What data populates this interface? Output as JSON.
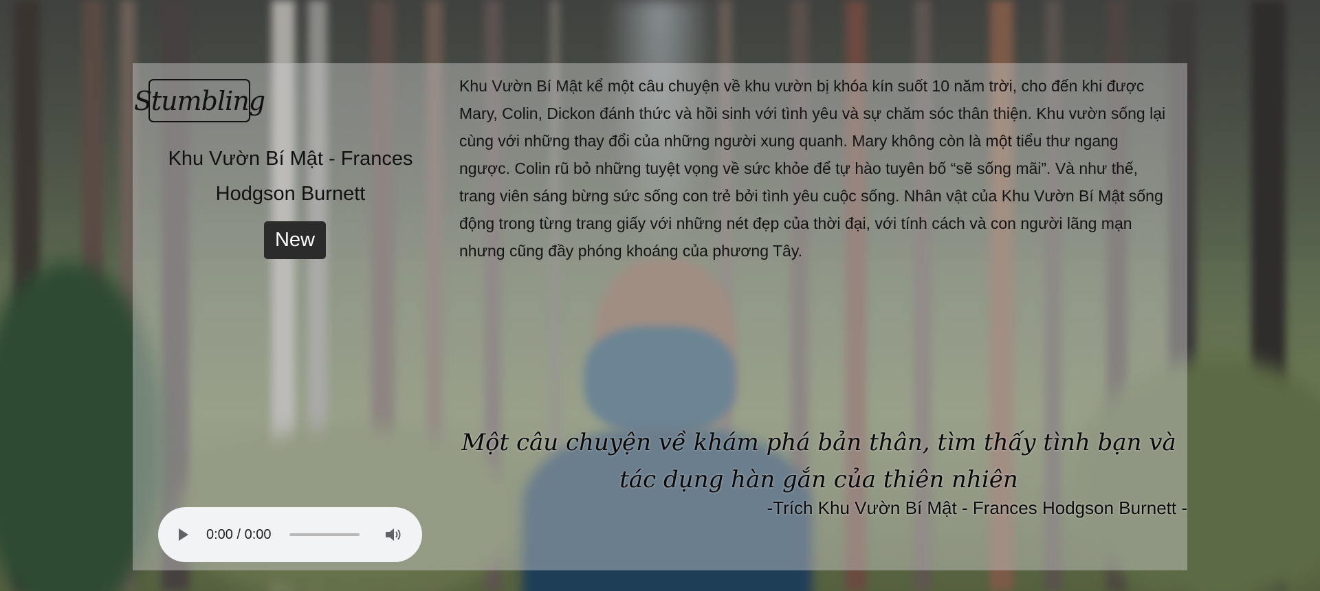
{
  "brand": {
    "logo_text": "Stumbling"
  },
  "book": {
    "title": "Khu Vườn Bí Mật - Frances Hodgson Burnett",
    "badge": "New"
  },
  "description": "Khu Vườn Bí Mật kể một câu chuyện về khu vườn bị khóa kín suốt 10 năm trời, cho đến khi được Mary, Colin, Dickon đánh thức và hồi sinh với tình yêu và sự chăm sóc thân thiện. Khu vườn sống lại cùng với những thay đổi của những người xung quanh. Mary không còn là một tiểu thư ngang ngược. Colin rũ bỏ những tuyệt vọng về sức khỏe để tự hào tuyên bố “sẽ sống mãi”. Và như thế, trang viên sáng bừng sức sống con trẻ bởi tình yêu cuộc sống. Nhân vật của Khu Vườn Bí Mật sống động trong từng trang giấy với những nét đẹp của thời đại, với tính cách và con người lãng mạn nhưng cũng đầy phóng khoáng của phương Tây.",
  "quote": {
    "text": "Một câu chuyện về khám phá bản thân, tìm thấy tình bạn và tác dụng hàn gắn của thiên nhiên",
    "source": "-Trích Khu Vườn Bí Mật - Frances Hodgson Burnett -"
  },
  "audio": {
    "time": "0:00 / 0:00",
    "play_icon": "play-icon",
    "volume_icon": "volume-icon"
  },
  "colors": {
    "badge_bg": "#2b2b2b",
    "badge_text": "#ffffff",
    "player_bg": "#f1f3f4"
  }
}
